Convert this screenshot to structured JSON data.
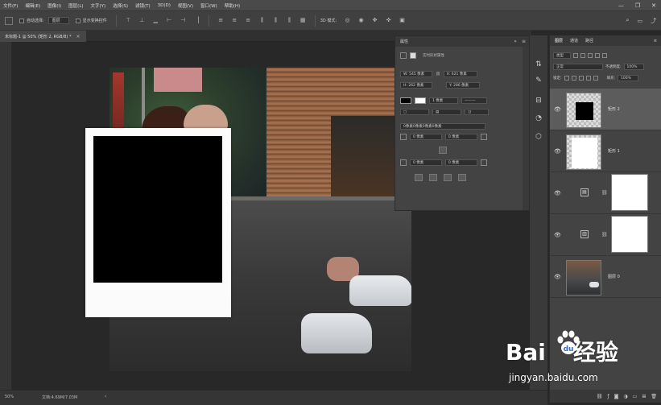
{
  "menu": [
    "文件(F)",
    "编辑(E)",
    "图像(I)",
    "图层(L)",
    "文字(Y)",
    "选择(S)",
    "滤镜(T)",
    "3D(D)",
    "视图(V)",
    "窗口(W)",
    "帮助(H)"
  ],
  "window_controls": {
    "minimize": "—",
    "restore": "❐",
    "close": "✕"
  },
  "options_bar": {
    "auto_select_label": "自动选择:",
    "target": "图层",
    "transform_label": "显示变换控件"
  },
  "document_tab": {
    "title": "未标题-1 @ 50% (矩形 2, RGB/8) *",
    "close": "×"
  },
  "properties": {
    "header": "属性",
    "type_label": "实时形状属性",
    "W": "W: 545 像素",
    "X": "X: 621 像素",
    "H": "H: 262 像素",
    "Y": "Y: 286 像素",
    "stroke_width": "1 像素",
    "corner_summary": "0像素0像素0像素0像素",
    "corner1": "0 像素",
    "corner2": "0 像素",
    "corner3": "0 像素",
    "corner4": "0 像素"
  },
  "layers_panel": {
    "tabs": [
      "图层",
      "通道",
      "路径"
    ],
    "filter": "类型",
    "blend_mode": "正常",
    "opacity_label": "不透明度:",
    "opacity": "100%",
    "lock_label": "锁定:",
    "fill_label": "填充:",
    "fill": "100%",
    "layers": [
      {
        "name": "矩形 2",
        "selected": true,
        "kind": "shape-black"
      },
      {
        "name": "矩形 1",
        "selected": false,
        "kind": "shape-white"
      },
      {
        "name": "",
        "selected": false,
        "kind": "adjustment"
      },
      {
        "name": "",
        "selected": false,
        "kind": "adjustment"
      },
      {
        "name": "图层 0",
        "selected": false,
        "kind": "photo"
      }
    ]
  },
  "status": {
    "zoom": "50%",
    "doc_size": "文档:4.69M/7.03M"
  },
  "watermark": {
    "brand": "Bai",
    "brand_cn": "经验",
    "url": "jingyan.baidu.com"
  }
}
